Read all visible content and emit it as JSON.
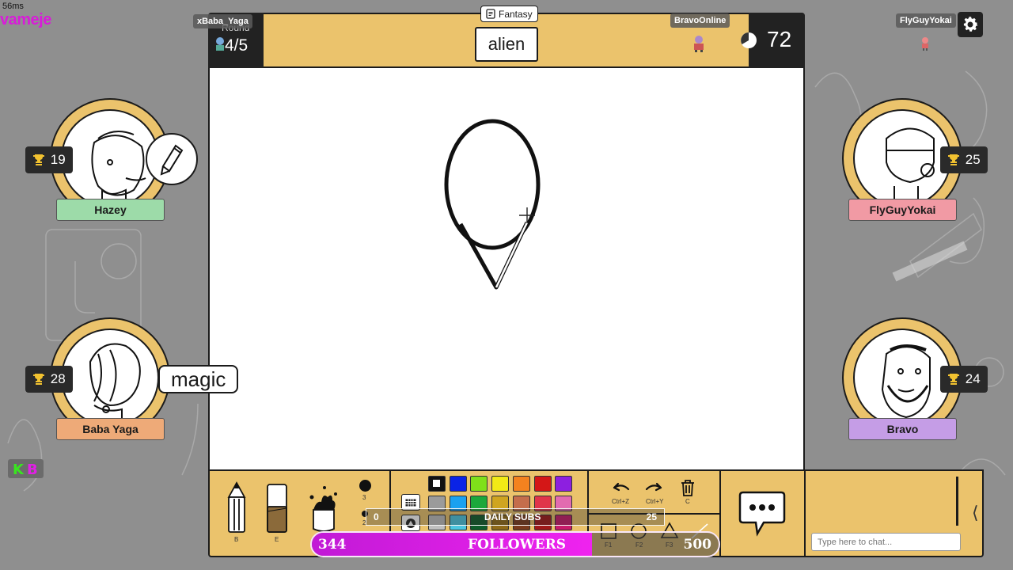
{
  "overlay": {
    "ping": "56ms",
    "brand": "vameje",
    "kb_logo": "KB"
  },
  "header": {
    "host_tag": "xBaba_Yaga",
    "round_label": "Round",
    "round_value": "4/5",
    "category": "Fantasy",
    "word": "alien",
    "drawer_tag": "BravoOnline",
    "timer": "72"
  },
  "viewer": {
    "name": "FlyGuyYokai"
  },
  "players": [
    {
      "name": "Hazey",
      "score": "19",
      "plate_color": "#9ddba9",
      "drawing": true
    },
    {
      "name": "Baba Yaga",
      "score": "28",
      "plate_color": "#eeaa78",
      "guess": "magic"
    },
    {
      "name": "FlyGuyYokai",
      "score": "25",
      "plate_color": "#f19aa4"
    },
    {
      "name": "Bravo",
      "score": "24",
      "plate_color": "#c59de6"
    }
  ],
  "toolbar": {
    "pencil_key": "B",
    "eraser_key": "E",
    "sizes": [
      "3",
      "2"
    ],
    "undo_key": "Ctrl+Z",
    "redo_key": "Ctrl+Y",
    "clear_key": "C",
    "shape_keys": [
      "F1",
      "F2",
      "F3"
    ],
    "colors_row1": [
      "#ffffff",
      "#0a23e6",
      "#7fe01a",
      "#f2ea16",
      "#f4821f",
      "#d41717",
      "#8d1fe0"
    ],
    "colors_row2": [
      "#9b9b9b",
      "#1aa1f0",
      "#1ba83b",
      "#cfa520",
      "#c46d4c",
      "#e0354a",
      "#e26bb0"
    ],
    "colors_row3": [
      "#bfbfbf",
      "#4cc6e0",
      "#0e5d2a",
      "#8f6a18",
      "#7a3a1c",
      "#a01818",
      "#c81a6a"
    ]
  },
  "chat": {
    "placeholder": "Type here to chat..."
  },
  "stream": {
    "subs_min": "0",
    "subs_label": "DAILY SUBS",
    "subs_goal": "25",
    "followers_count": "344",
    "followers_label": "FOLLOWERS",
    "followers_goal": "500",
    "followers_progress": 0.688
  }
}
